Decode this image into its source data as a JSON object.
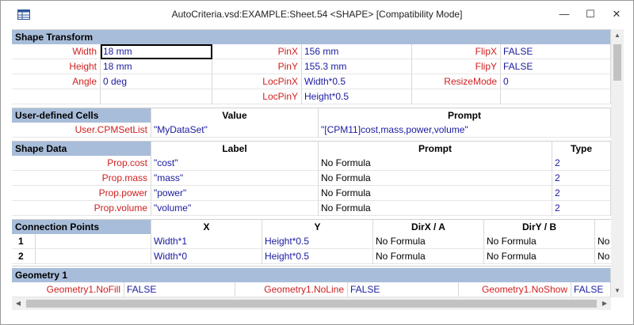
{
  "window": {
    "title": "AutoCriteria.vsd:EXAMPLE:Sheet.54 <SHAPE>  [Compatibility Mode]",
    "minimize_glyph": "—",
    "maximize_glyph": "☐",
    "close_glyph": "✕"
  },
  "shape_transform": {
    "header": "Shape Transform",
    "rows": [
      {
        "l1": "Width",
        "v1": "18 mm",
        "l2": "PinX",
        "v2": "156 mm",
        "l3": "FlipX",
        "v3": "FALSE"
      },
      {
        "l1": "Height",
        "v1": "18 mm",
        "l2": "PinY",
        "v2": "155.3 mm",
        "l3": "FlipY",
        "v3": "FALSE"
      },
      {
        "l1": "Angle",
        "v1": "0 deg",
        "l2": "LocPinX",
        "v2": "Width*0.5",
        "l3": "ResizeMode",
        "v3": "0"
      },
      {
        "l1": "",
        "v1": "",
        "l2": "LocPinY",
        "v2": "Height*0.5",
        "l3": "",
        "v3": ""
      }
    ]
  },
  "user_defined": {
    "header": "User-defined Cells",
    "col_value": "Value",
    "col_prompt": "Prompt",
    "rows": [
      {
        "name": "User.CPMSetList",
        "value": "\"MyDataSet\"",
        "prompt": "\"[CPM11]cost,mass,power,volume\""
      }
    ]
  },
  "shape_data": {
    "header": "Shape Data",
    "col_label": "Label",
    "col_prompt": "Prompt",
    "col_type": "Type",
    "rows": [
      {
        "name": "Prop.cost",
        "label": "\"cost\"",
        "prompt": "No Formula",
        "type": "2"
      },
      {
        "name": "Prop.mass",
        "label": "\"mass\"",
        "prompt": "No Formula",
        "type": "2"
      },
      {
        "name": "Prop.power",
        "label": "\"power\"",
        "prompt": "No Formula",
        "type": "2"
      },
      {
        "name": "Prop.volume",
        "label": "\"volume\"",
        "prompt": "No Formula",
        "type": "2"
      }
    ]
  },
  "connection_points": {
    "header": "Connection Points",
    "col_x": "X",
    "col_y": "Y",
    "col_dirx": "DirX / A",
    "col_diry": "DirY / B",
    "rows": [
      {
        "num": "1",
        "x": "Width*1",
        "y": "Height*0.5",
        "dirx": "No Formula",
        "diry": "No Formula",
        "extra": "No"
      },
      {
        "num": "2",
        "x": "Width*0",
        "y": "Height*0.5",
        "dirx": "No Formula",
        "diry": "No Formula",
        "extra": "No"
      }
    ]
  },
  "geometry": {
    "header": "Geometry 1",
    "cells": [
      {
        "label": "Geometry1.NoFill",
        "value": "FALSE"
      },
      {
        "label": "Geometry1.NoLine",
        "value": "FALSE"
      },
      {
        "label": "Geometry1.NoShow",
        "value": "FALSE"
      }
    ]
  },
  "icons": {
    "app": "shapesheet-grid-icon",
    "scroll_up": "scroll-up-arrow-icon",
    "scroll_down": "scroll-down-arrow-icon",
    "scroll_left": "scroll-left-arrow-icon",
    "scroll_right": "scroll-right-arrow-icon"
  }
}
